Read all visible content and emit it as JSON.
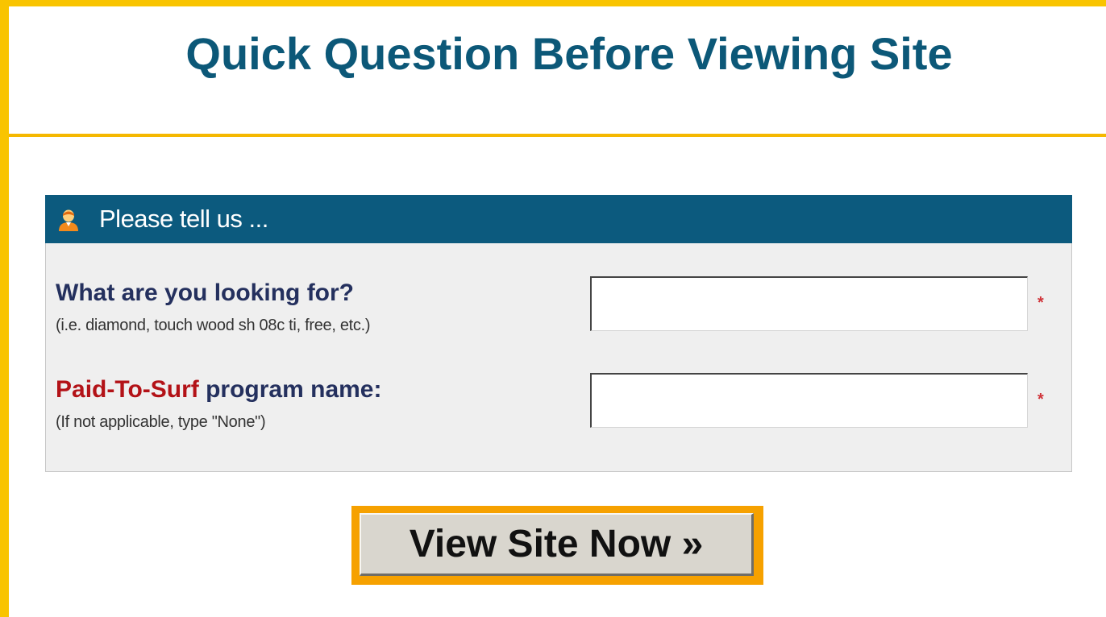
{
  "header": {
    "title": "Quick Question Before Viewing Site"
  },
  "panel": {
    "title": "Please tell us ...",
    "icon": "user-icon"
  },
  "fields": [
    {
      "question": "What are you looking for?",
      "hint": "(i.e. diamond, touch wood sh 08c ti, free, etc.)",
      "value": "",
      "required_mark": "*"
    },
    {
      "question_highlight": "Paid-To-Surf",
      "question_rest": " program name:",
      "hint": "(If not applicable, type \"None\")",
      "value": "",
      "required_mark": "*"
    }
  ],
  "button": {
    "label": "View Site Now »"
  },
  "colors": {
    "frame": "#f9c400",
    "title": "#0c5878",
    "panel_header": "#0c5a7e",
    "highlight": "#b31217",
    "button_border": "#f6a100"
  }
}
